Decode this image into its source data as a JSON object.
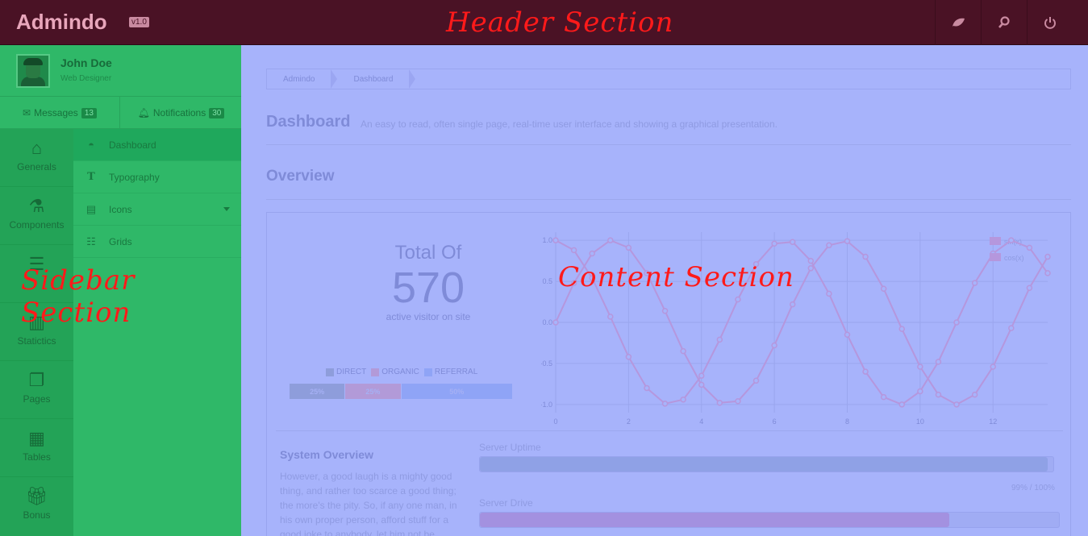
{
  "header": {
    "brand": "Admindo",
    "version": "v1.0",
    "annotation": "Header Section",
    "buttons": [
      "leaf-icon",
      "search-icon",
      "power-icon"
    ]
  },
  "sidebar": {
    "annotation": "Sidebar Section",
    "user": {
      "name": "John Doe",
      "role": "Web Designer"
    },
    "messages": {
      "label": "Messages",
      "count": "13"
    },
    "notifications": {
      "label": "Notifications",
      "count": "30"
    },
    "rail": [
      {
        "label": "Generals",
        "icon": "home-icon"
      },
      {
        "label": "Components",
        "icon": "flask-icon"
      },
      {
        "label": "",
        "icon": "list-icon"
      },
      {
        "label": "Statictics",
        "icon": "bar-chart-icon"
      },
      {
        "label": "Pages",
        "icon": "pages-icon"
      },
      {
        "label": "Tables",
        "icon": "table-icon"
      },
      {
        "label": "Bonus",
        "icon": "gift-icon"
      }
    ],
    "submenu": [
      {
        "label": "Dashboard",
        "icon": "dashboard-icon"
      },
      {
        "label": "Typography",
        "icon": "type-icon"
      },
      {
        "label": "Icons",
        "icon": "icons-icon"
      },
      {
        "label": "Grids",
        "icon": "grid-icon"
      }
    ]
  },
  "content": {
    "annotation": "Content Section",
    "breadcrumb": [
      "Admindo",
      "Dashboard"
    ],
    "title": "Dashboard",
    "subtitle": "An easy to read, often single page, real-time user interface and showing a graphical presentation.",
    "overview": "Overview",
    "stats": {
      "total_of": "Total Of",
      "count": "570",
      "caption": "active visitor on site",
      "legend": [
        {
          "name": "DIRECT",
          "color": "#8e9ddb"
        },
        {
          "name": "ORGANIC",
          "color": "#b29ad8"
        },
        {
          "name": "REFERRAL",
          "color": "#8fa4f6"
        }
      ],
      "segments": [
        {
          "label": "25%",
          "value": 25,
          "color": "#8e9ddb"
        },
        {
          "label": "25%",
          "value": 25,
          "color": "#b29ad8"
        },
        {
          "label": "50%",
          "value": 50,
          "color": "#8fa4f6"
        }
      ]
    },
    "system": {
      "title": "System Overview",
      "text": "However, a good laugh is a mighty good thing, and rather too scarce a good thing; the more's the pity. So, if any one man, in his own proper person, afford stuff for a good joke to anybody, let him not be",
      "bars": [
        {
          "label": "Server Uptime",
          "value": 0.99,
          "pct": "99% / 100%",
          "color": "#8fa1e6"
        },
        {
          "label": "Server Drive",
          "value": 0.81,
          "pct": "",
          "color": "#a391e0"
        }
      ]
    }
  },
  "chart_data": {
    "type": "line",
    "xlim": [
      0,
      13.5
    ],
    "ylim": [
      -1.1,
      1.1
    ],
    "xticks": [
      0,
      2,
      4,
      6,
      8,
      10,
      12
    ],
    "yticks": [
      1.0,
      0.5,
      0.0,
      -0.5,
      -1.0
    ],
    "ytick_labels": [
      "1.0",
      "0.5",
      "0.0",
      "-0.5",
      "-1.0"
    ],
    "grid": true,
    "legend_position": "top-right",
    "series": [
      {
        "name": "sin(x)",
        "color": "#b597dd",
        "x": [
          0,
          0.5,
          1,
          1.5,
          2,
          2.5,
          3,
          3.5,
          4,
          4.5,
          5,
          5.5,
          6,
          6.5,
          7,
          7.5,
          8,
          8.5,
          9,
          9.5,
          10,
          10.5,
          11,
          11.5,
          12,
          12.5,
          13,
          13.5
        ],
        "values": [
          0,
          0.48,
          0.84,
          1.0,
          0.91,
          0.6,
          0.14,
          -0.35,
          -0.76,
          -0.98,
          -0.96,
          -0.71,
          -0.28,
          0.22,
          0.66,
          0.94,
          0.99,
          0.8,
          0.41,
          -0.08,
          -0.54,
          -0.88,
          -1.0,
          -0.88,
          -0.54,
          -0.07,
          0.42,
          0.8
        ]
      },
      {
        "name": "cos(x)",
        "color": "#b597dd",
        "x": [
          0,
          0.5,
          1,
          1.5,
          2,
          2.5,
          3,
          3.5,
          4,
          4.5,
          5,
          5.5,
          6,
          6.5,
          7,
          7.5,
          8,
          8.5,
          9,
          9.5,
          10,
          10.5,
          11,
          11.5,
          12,
          12.5,
          13,
          13.5
        ],
        "values": [
          1.0,
          0.88,
          0.54,
          0.07,
          -0.42,
          -0.8,
          -0.99,
          -0.94,
          -0.65,
          -0.21,
          0.28,
          0.71,
          0.96,
          0.98,
          0.75,
          0.35,
          -0.15,
          -0.6,
          -0.91,
          -1.0,
          -0.84,
          -0.48,
          0.0,
          0.48,
          0.84,
          1.0,
          0.91,
          0.6
        ]
      }
    ]
  }
}
